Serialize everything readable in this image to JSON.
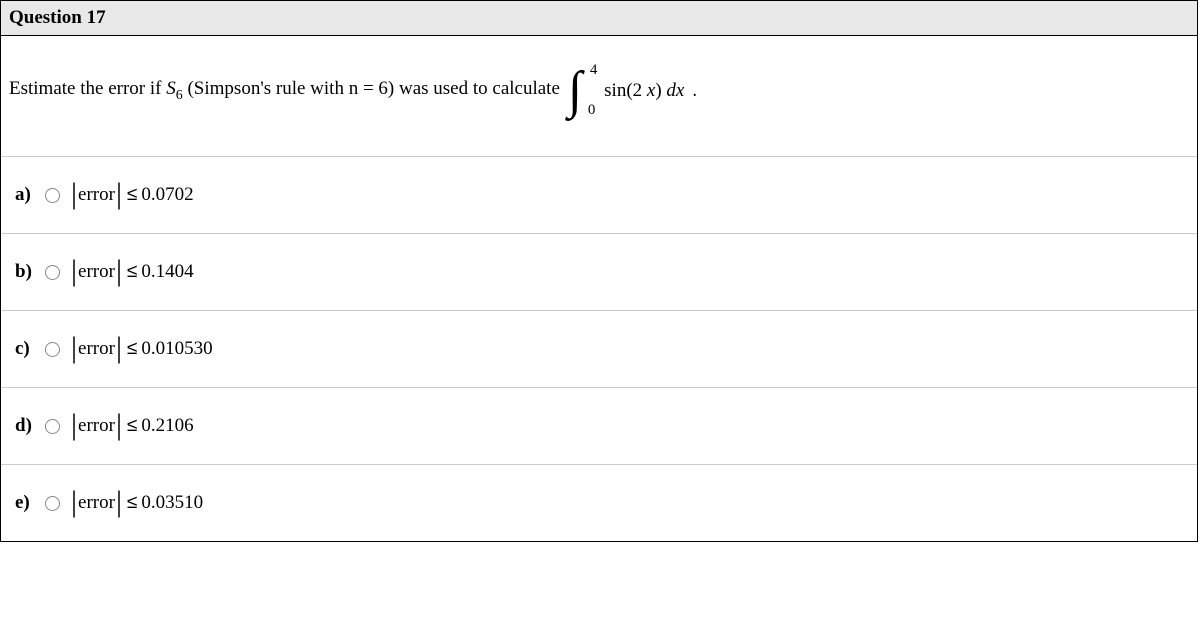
{
  "header": {
    "title": "Question 17"
  },
  "prompt": {
    "text_before": "Estimate the error if ",
    "S_symbol": "S",
    "S_sub": "6",
    "text_mid": " (Simpson's rule with n = 6) was used to calculate",
    "int_upper": "4",
    "int_lower": "0",
    "integrand": "sin(2 x) dx",
    "tail": " ."
  },
  "options": [
    {
      "letter": "a)",
      "abs_text": "error",
      "rel": "≤",
      "value": "0.0702"
    },
    {
      "letter": "b)",
      "abs_text": "error",
      "rel": "≤",
      "value": "0.1404"
    },
    {
      "letter": "c)",
      "abs_text": "error",
      "rel": "≤",
      "value": "0.010530"
    },
    {
      "letter": "d)",
      "abs_text": "error",
      "rel": "≤",
      "value": "0.2106"
    },
    {
      "letter": "e)",
      "abs_text": "error",
      "rel": "≤",
      "value": "0.03510"
    }
  ]
}
